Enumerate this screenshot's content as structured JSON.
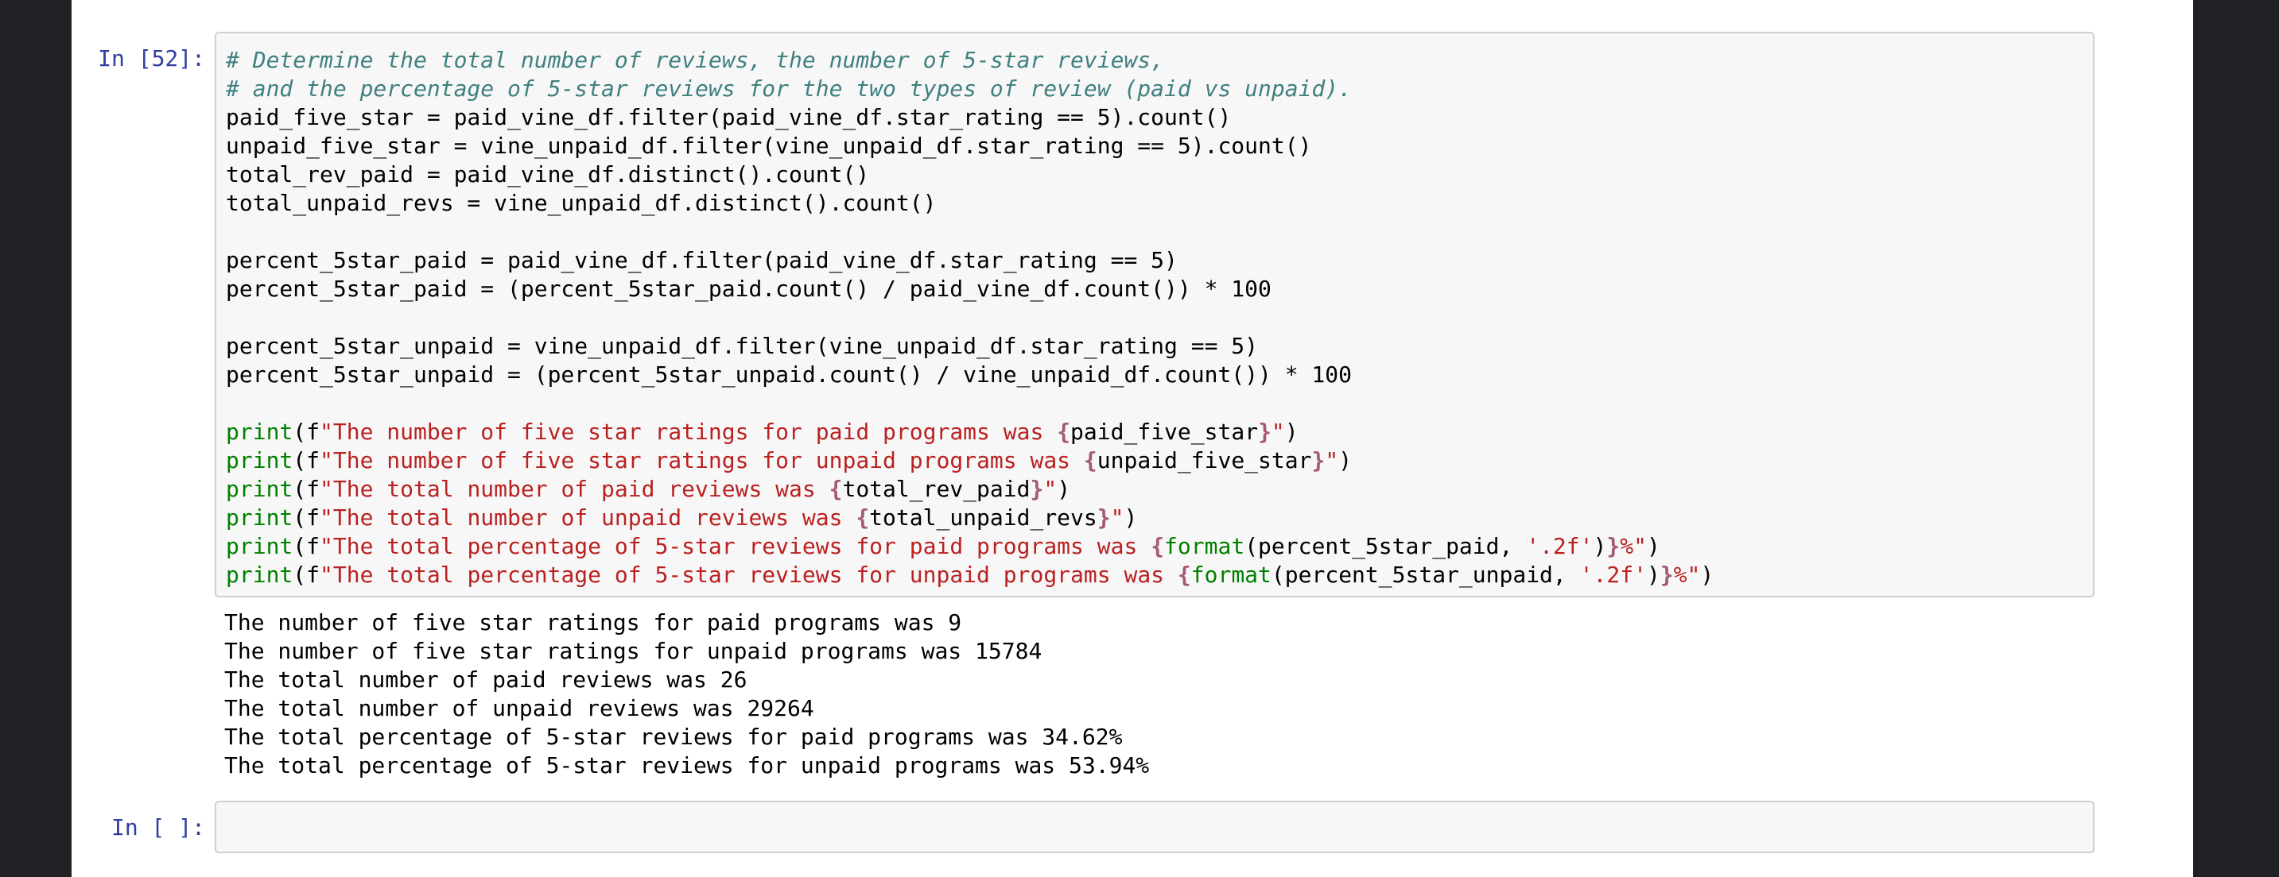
{
  "cells": [
    {
      "prompt": "In [52]:",
      "code": {
        "l1": "# Determine the total number of reviews, the number of 5-star reviews,",
        "l2": "# and the percentage of 5-star reviews for the two types of review (paid vs unpaid).",
        "l3": "paid_five_star = paid_vine_df.filter(paid_vine_df.star_rating == 5).count()",
        "l4": "unpaid_five_star = vine_unpaid_df.filter(vine_unpaid_df.star_rating == 5).count()",
        "l5": "total_rev_paid = paid_vine_df.distinct().count()",
        "l6": "total_unpaid_revs = vine_unpaid_df.distinct().count()",
        "l8": "percent_5star_paid = paid_vine_df.filter(paid_vine_df.star_rating == 5)",
        "l9": "percent_5star_paid = (percent_5star_paid.count() / paid_vine_df.count()) * 100",
        "l11": "percent_5star_unpaid = vine_unpaid_df.filter(vine_unpaid_df.star_rating == 5)",
        "l12": "percent_5star_unpaid = (percent_5star_unpaid.count() / vine_unpaid_df.count()) * 100",
        "p1": {
          "fn": "print",
          "pre": "(f",
          "str": "\"The number of five star ratings for paid programs was ",
          "ob": "{",
          "var": "paid_five_star",
          "cb": "}",
          "end": "\"",
          "close": ")"
        },
        "p2": {
          "fn": "print",
          "pre": "(f",
          "str": "\"The number of five star ratings for unpaid programs was ",
          "ob": "{",
          "var": "unpaid_five_star",
          "cb": "}",
          "end": "\"",
          "close": ")"
        },
        "p3": {
          "fn": "print",
          "pre": "(f",
          "str": "\"The total number of paid reviews was ",
          "ob": "{",
          "var": "total_rev_paid",
          "cb": "}",
          "end": "\"",
          "close": ")"
        },
        "p4": {
          "fn": "print",
          "pre": "(f",
          "str": "\"The total number of unpaid reviews was ",
          "ob": "{",
          "var": "total_unpaid_revs",
          "cb": "}",
          "end": "\"",
          "close": ")"
        },
        "p5": {
          "fn": "print",
          "pre": "(f",
          "str": "\"The total percentage of 5-star reviews for paid programs was ",
          "ob": "{",
          "fmt": "format",
          "args": "(percent_5star_paid, ",
          "fstr": "'.2f'",
          "argsclose": ")",
          "cb": "}",
          "end": "%\"",
          "close": ")"
        },
        "p6": {
          "fn": "print",
          "pre": "(f",
          "str": "\"The total percentage of 5-star reviews for unpaid programs was ",
          "ob": "{",
          "fmt": "format",
          "args": "(percent_5star_unpaid, ",
          "fstr": "'.2f'",
          "argsclose": ")",
          "cb": "}",
          "end": "%\"",
          "close": ")"
        }
      },
      "output": [
        "The number of five star ratings for paid programs was 9",
        "The number of five star ratings for unpaid programs was 15784",
        "The total number of paid reviews was 26",
        "The total number of unpaid reviews was 29264",
        "The total percentage of 5-star reviews for paid programs was 34.62%",
        "The total percentage of 5-star reviews for unpaid programs was 53.94%"
      ]
    },
    {
      "prompt": "In [ ]:"
    }
  ],
  "colors": {
    "prompt": "#303f9f",
    "comment": "#408080",
    "builtin": "#008000",
    "string": "#ba2121",
    "number": "#666666",
    "background": "#1f2125"
  }
}
